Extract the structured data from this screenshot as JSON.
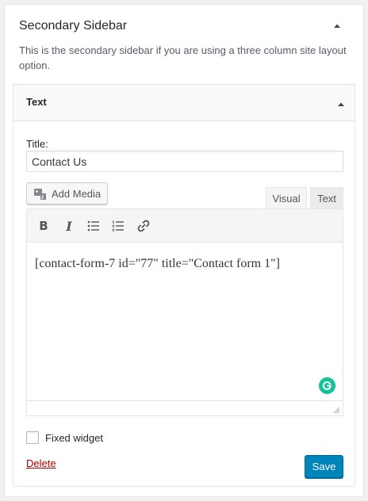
{
  "sidebar": {
    "title": "Secondary Sidebar",
    "description": "This is the secondary sidebar if you are using a three column site layout option."
  },
  "widget": {
    "title": "Text",
    "title_label": "Title:",
    "title_value": "Contact Us",
    "add_media_label": "Add Media",
    "tabs": {
      "visual": "Visual",
      "text": "Text"
    },
    "toolbar": {
      "bold": "B",
      "italic": "I"
    },
    "content": "[contact-form-7 id=\"77\" title=\"Contact form 1\"]",
    "fixed_widget_label": "Fixed widget",
    "delete_label": "Delete",
    "save_label": "Save"
  },
  "icons": {
    "panel_toggle": "triangle-up-icon",
    "widget_toggle": "triangle-up-icon",
    "add_media": "media-icon",
    "bulleted_list": "bulleted-list-icon",
    "numbered_list": "numbered-list-icon",
    "link": "link-icon",
    "grammarly": "grammarly-icon",
    "resize": "resize-handle-icon"
  },
  "colors": {
    "accent": "#0085ba",
    "delete": "#a00000",
    "grammarly": "#15c39a"
  }
}
